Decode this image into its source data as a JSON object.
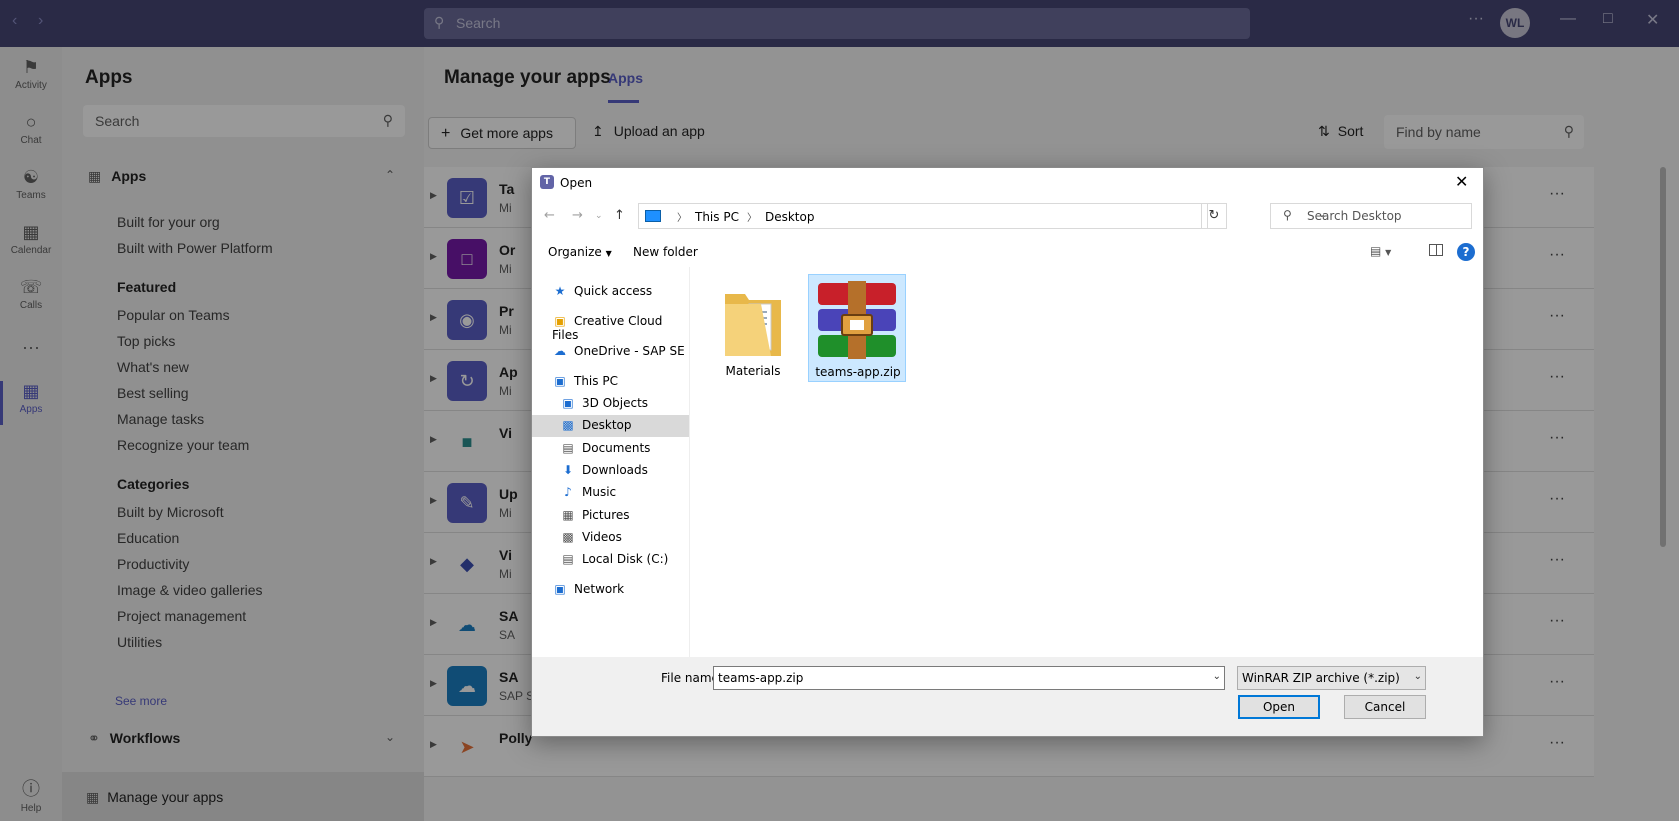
{
  "titlebar": {
    "search_placeholder": "Search",
    "avatar_initials": "WL"
  },
  "rail": {
    "items": [
      {
        "label": "Activity",
        "icon": "bell-icon"
      },
      {
        "label": "Chat",
        "icon": "chat-icon"
      },
      {
        "label": "Teams",
        "icon": "teams-icon"
      },
      {
        "label": "Calendar",
        "icon": "calendar-icon"
      },
      {
        "label": "Calls",
        "icon": "phone-icon"
      },
      {
        "label": "Apps",
        "icon": "apps-icon"
      },
      {
        "label": "Help",
        "icon": "help-icon"
      }
    ]
  },
  "leftpanel": {
    "title": "Apps",
    "search_placeholder": "Search",
    "apps_section": "Apps",
    "links": [
      "Built for your org",
      "Built with Power Platform"
    ],
    "featured_head": "Featured",
    "featured": [
      "Popular on Teams",
      "Top picks",
      "What's new",
      "Best selling",
      "Manage tasks",
      "Recognize your team"
    ],
    "categories_head": "Categories",
    "categories": [
      "Built by Microsoft",
      "Education",
      "Productivity",
      "Image & video galleries",
      "Project management",
      "Utilities"
    ],
    "see_more": "See more",
    "workflows": "Workflows",
    "manage": "Manage your apps"
  },
  "main": {
    "title": "Manage your apps",
    "tab": "Apps",
    "get_more": "Get more apps",
    "upload": "Upload an app",
    "sort": "Sort",
    "find_placeholder": "Find by name",
    "rows": [
      {
        "name": "Ta",
        "sub": "Mi",
        "color": "#5b5fc7"
      },
      {
        "name": "Or",
        "sub": "Mi",
        "color": "#7719aa"
      },
      {
        "name": "Pr",
        "sub": "Mi",
        "color": "#5b5fc7"
      },
      {
        "name": "Ap",
        "sub": "Mi",
        "color": "#5b5fc7"
      },
      {
        "name": "Vi",
        "sub": "",
        "color": "#ffffff"
      },
      {
        "name": "Up",
        "sub": "Mi",
        "color": "#5b5fc7"
      },
      {
        "name": "Vi",
        "sub": "Mi",
        "color": "#ffffff"
      },
      {
        "name": "SA",
        "sub": "SA",
        "color": "#ffffff"
      },
      {
        "name": "SA",
        "sub": "SAP SE",
        "color": "#1b7fc4"
      },
      {
        "name": "Polly",
        "sub": "",
        "color": "#ffffff"
      }
    ]
  },
  "dialog": {
    "title": "Open",
    "breadcrumb": [
      "This PC",
      "Desktop"
    ],
    "search_placeholder": "Search Desktop",
    "organize": "Organize",
    "new_folder": "New folder",
    "nav": [
      {
        "label": "Quick access",
        "icon": "star-icon",
        "indent": 0
      },
      {
        "label": "Creative Cloud Files",
        "icon": "creative-cloud-icon",
        "indent": 0
      },
      {
        "label": "OneDrive - SAP SE",
        "icon": "cloud-icon",
        "indent": 0
      },
      {
        "label": "This PC",
        "icon": "computer-icon",
        "indent": 0
      },
      {
        "label": "3D Objects",
        "icon": "cube-icon",
        "indent": 1
      },
      {
        "label": "Desktop",
        "icon": "desktop-icon",
        "indent": 1
      },
      {
        "label": "Documents",
        "icon": "document-icon",
        "indent": 1
      },
      {
        "label": "Downloads",
        "icon": "download-icon",
        "indent": 1
      },
      {
        "label": "Music",
        "icon": "music-icon",
        "indent": 1
      },
      {
        "label": "Pictures",
        "icon": "picture-icon",
        "indent": 1
      },
      {
        "label": "Videos",
        "icon": "video-icon",
        "indent": 1
      },
      {
        "label": "Local Disk (C:)",
        "icon": "disk-icon",
        "indent": 1
      },
      {
        "label": "Network",
        "icon": "network-icon",
        "indent": 0
      }
    ],
    "selected_nav": "Desktop",
    "files": [
      {
        "name": "Materials",
        "icon": "folder-icon"
      },
      {
        "name": "teams-app.zip",
        "icon": "winrar-archive-icon"
      }
    ],
    "file_name_label": "File name:",
    "file_name_value": "teams-app.zip",
    "file_type": "WinRAR ZIP archive (*.zip)",
    "open": "Open",
    "cancel": "Cancel"
  }
}
